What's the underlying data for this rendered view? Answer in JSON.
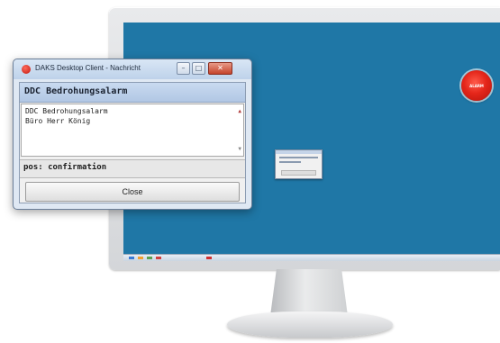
{
  "desktop": {
    "alarm_button_label": "ALARM"
  },
  "dialog": {
    "title": "DAKS Desktop Client - Nachricht",
    "heading": "DDC Bedrohungsalarm",
    "message_lines": [
      "DDC Bedrohungsalarm",
      "Büro Herr König"
    ],
    "status": "pos: confirmation",
    "close_label": "Close",
    "window_buttons": {
      "minimize": "–",
      "maximize": "□",
      "close": "✕"
    }
  },
  "colors": {
    "desktop_background": "#1f77a6",
    "alarm_red": "#e4261a",
    "heading_bar": "#b1c7e4"
  }
}
